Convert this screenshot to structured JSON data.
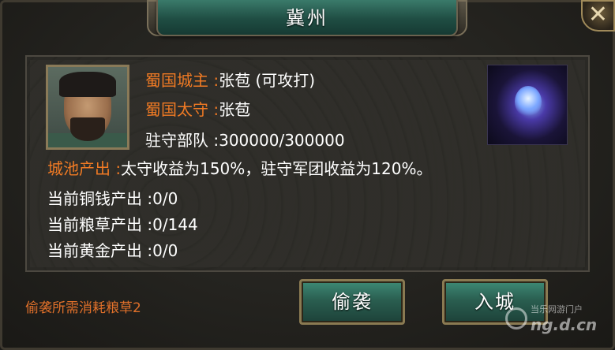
{
  "dialog": {
    "title": "冀州",
    "close_glyph": "✕"
  },
  "info": {
    "lord": {
      "label": "蜀国城主 :",
      "value": "张苞 (可攻打)"
    },
    "governor": {
      "label": "蜀国太守 :",
      "value": "张苞"
    },
    "garrison": {
      "label": "驻守部队 :",
      "value": "300000/300000"
    },
    "city_output": {
      "label": "城池产出 :",
      "value": "太守收益为150%，驻守军团收益为120%。"
    },
    "copper": {
      "label": "当前铜钱产出 :",
      "value": "0/0"
    },
    "grain": {
      "label": "当前粮草产出 :",
      "value": "0/144"
    },
    "gold": {
      "label": "当前黄金产出 :",
      "value": "0/0"
    }
  },
  "footer": {
    "note": "偷袭所需消耗粮草2"
  },
  "buttons": {
    "sneak_attack": "偷袭",
    "enter_city": "入城"
  },
  "watermark": {
    "line1": "当乐网游门户",
    "line2": "ng.d.cn"
  },
  "icons": {
    "portrait": "general-portrait",
    "item": "magic-orb-icon",
    "close": "close-icon"
  },
  "colors": {
    "label_orange": "#f07a24",
    "title_green": "#2a6a5a",
    "button_green": "#2a5e50",
    "footer_note": "#e0702a"
  }
}
